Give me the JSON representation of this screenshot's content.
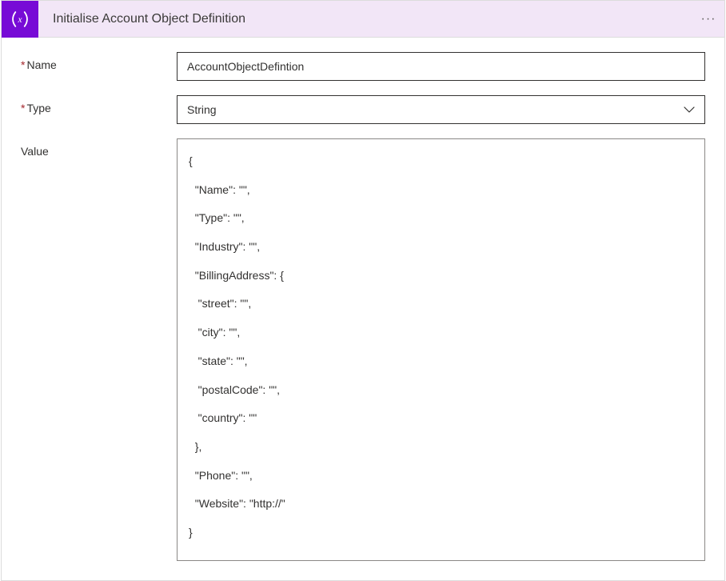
{
  "header": {
    "title": "Initialise Account Object Definition"
  },
  "fields": {
    "name": {
      "label": "Name",
      "required_marker": "*",
      "value": "AccountObjectDefintion"
    },
    "type": {
      "label": "Type",
      "required_marker": "*",
      "value": "String"
    },
    "value": {
      "label": "Value",
      "content": "{\n  \"Name\": \"\",\n  \"Type\": \"\",\n  \"Industry\": \"\",\n  \"BillingAddress\": {\n   \"street\": \"\",\n   \"city\": \"\",\n   \"state\": \"\",\n   \"postalCode\": \"\",\n   \"country\": \"\"\n  },\n  \"Phone\": \"\",\n  \"Website\": \"http://\"\n}"
    }
  }
}
